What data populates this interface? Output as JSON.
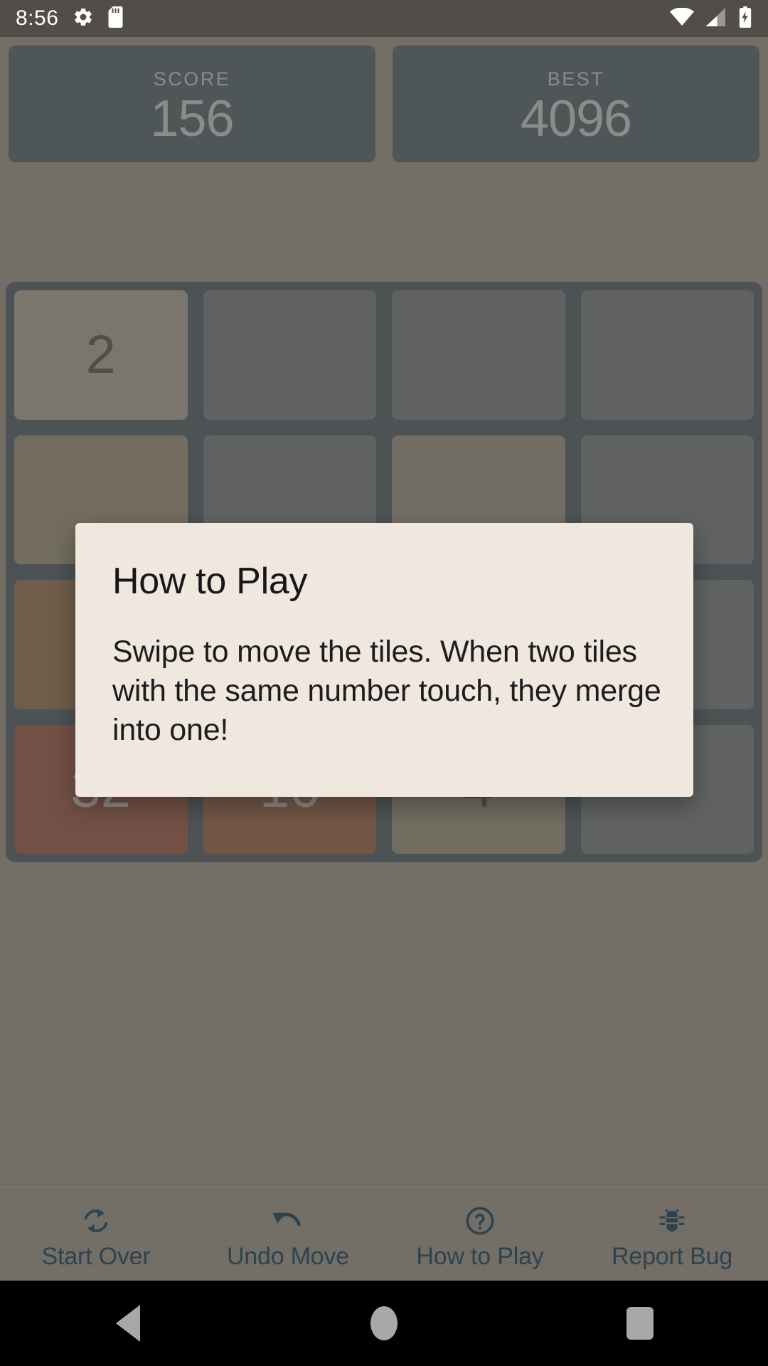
{
  "status_bar": {
    "clock": "8:56",
    "left_icons": [
      "settings-gear-icon",
      "sd-card-icon"
    ],
    "right_icons": [
      "wifi-icon",
      "cellular-signal-icon",
      "battery-charging-icon"
    ],
    "background_color": "#514e49"
  },
  "scoreboard": {
    "score": {
      "label": "SCORE",
      "value": "156"
    },
    "best": {
      "label": "BEST",
      "value": "4096"
    },
    "card_color": "#2e3f48",
    "text_color": "#9aa1a5"
  },
  "board": {
    "background_color": "#2b3a44",
    "empty_cell_color": "#4e565a",
    "rows": [
      [
        {
          "value": "2",
          "bg": "#7c7870",
          "fg": "#32302b"
        },
        {
          "value": "",
          "bg": "#4e565a",
          "fg": "#4e565a"
        },
        {
          "value": "",
          "bg": "#4e565a",
          "fg": "#4e565a"
        },
        {
          "value": "",
          "bg": "#4e565a",
          "fg": "#4e565a"
        }
      ],
      [
        {
          "value": "",
          "bg": "#6d6857",
          "fg": "#6d6857"
        },
        {
          "value": "",
          "bg": "#4e565a",
          "fg": "#4e565a"
        },
        {
          "value": "",
          "bg": "#6f6a5e",
          "fg": "#6f6a5e"
        },
        {
          "value": "",
          "bg": "#4e565a",
          "fg": "#4e565a"
        }
      ],
      [
        {
          "value": "",
          "bg": "#6b4e33",
          "fg": "#6b4e33"
        },
        {
          "value": "",
          "bg": "#676253",
          "fg": "#676253"
        },
        {
          "value": "",
          "bg": "#4e565a",
          "fg": "#4e565a"
        },
        {
          "value": "",
          "bg": "#4e565a",
          "fg": "#4e565a"
        }
      ],
      [
        {
          "value": "32",
          "bg": "#6e3427",
          "fg": "#9d9b96"
        },
        {
          "value": "16",
          "bg": "#6e4029",
          "fg": "#9d9b96"
        },
        {
          "value": "4",
          "bg": "#6c6959",
          "fg": "#32302b"
        },
        {
          "value": "",
          "bg": "#4e565a",
          "fg": "#4e565a"
        }
      ]
    ]
  },
  "dialog": {
    "title": "How to Play",
    "body": "Swipe to move the tiles. When two tiles with the same number touch, they merge into one!",
    "background_color": "#f0e8df",
    "title_color": "#17171a"
  },
  "toolbar": {
    "items": [
      {
        "label": "Start Over",
        "icon": "refresh-icon"
      },
      {
        "label": "Undo Move",
        "icon": "undo-arrow-icon"
      },
      {
        "label": "How to Play",
        "icon": "question-circle-icon"
      },
      {
        "label": "Report Bug",
        "icon": "bug-icon"
      }
    ],
    "accent_color": "#2e4350"
  },
  "nav_bar": {
    "buttons": [
      "back-triangle-icon",
      "home-circle-icon",
      "recents-square-icon"
    ],
    "background_color": "#000000",
    "icon_color": "#a8a8a8"
  }
}
